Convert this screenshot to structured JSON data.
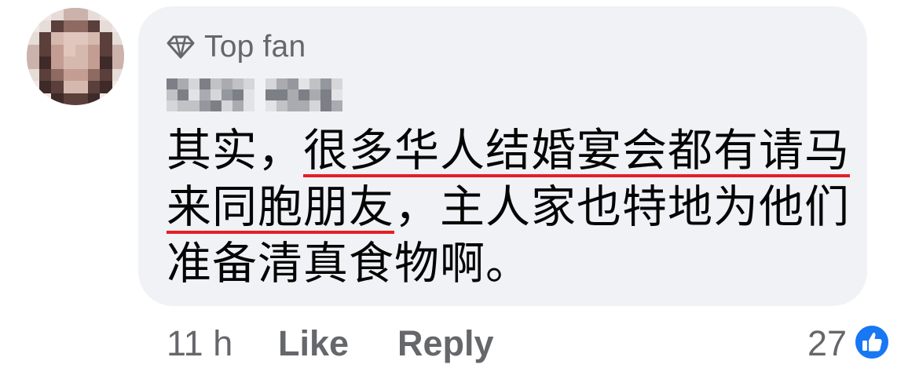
{
  "comment": {
    "badge_label": "Top fan",
    "author_name": "Coral Fox",
    "text_before": "其实，",
    "text_underlined_1": "很多华人结婚宴会都有请",
    "text_underlined_2": "马来同胞朋友",
    "text_after": "，主人家也特地为他们准备清真食物啊。",
    "timestamp": "11 h",
    "like_label": "Like",
    "reply_label": "Reply",
    "reaction_count": "27"
  },
  "icons": {
    "badge": "diamond-icon",
    "reaction": "thumbs-up-icon"
  },
  "colors": {
    "bubble_bg": "#f0f2f5",
    "secondary_text": "#65676b",
    "primary_text": "#050505",
    "underline": "#e41e26",
    "like_blue": "#1877f2"
  }
}
